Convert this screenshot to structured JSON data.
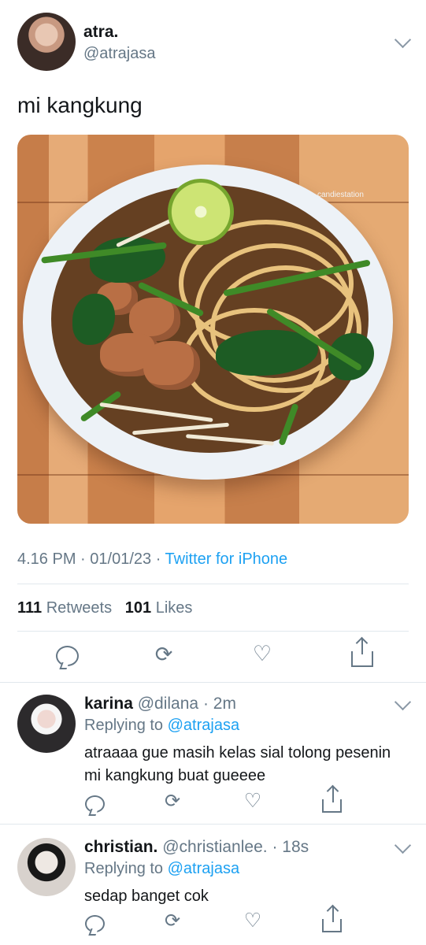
{
  "tweet": {
    "display_name": "atra.",
    "handle": "@atrajasa",
    "text": "mi kangkung",
    "image_watermark": "candiestation",
    "time": "4.16 PM",
    "date": "01/01/23",
    "source": "Twitter for iPhone",
    "retweets": "111",
    "retweets_label": "Retweets",
    "likes": "101",
    "likes_label": "Likes"
  },
  "replies": [
    {
      "display_name": "karina",
      "handle": "@dilana",
      "time": "2m",
      "replying_to_label": "Replying to",
      "replying_to_handle": "@atrajasa",
      "text": "atraaaa gue masih kelas sial tolong pesenin mi kangkung buat gueeee"
    },
    {
      "display_name": "christian.",
      "handle": "@christianlee.",
      "time": "18s",
      "replying_to_label": "Replying to",
      "replying_to_handle": "@atrajasa",
      "text": "sedap banget cok"
    }
  ],
  "icons": {
    "reply": "speech-bubble-icon",
    "retweet": "retweet-icon",
    "like": "heart-icon",
    "share": "share-icon",
    "menu": "chevron-down-icon"
  },
  "colors": {
    "link": "#1da1f2",
    "secondary_text": "#657786",
    "divider": "#e1e8ed"
  }
}
